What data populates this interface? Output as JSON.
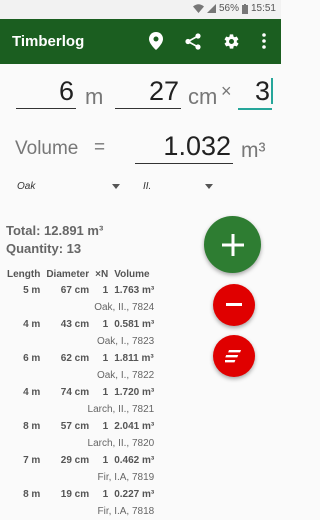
{
  "status": {
    "battery": "56%",
    "time": "15:51"
  },
  "appbar": {
    "title": "Timberlog"
  },
  "inputs": {
    "length_m": "6",
    "length_unit": "m",
    "length_cm": "27",
    "cm_unit": "cm",
    "times": "×",
    "count": "3"
  },
  "volume": {
    "label": "Volume",
    "equals": "=",
    "value": "1.032",
    "unit": "m³"
  },
  "dropdowns": {
    "species": "Oak",
    "grade": "II."
  },
  "summary": {
    "total": "Total: 12.891 m³",
    "quantity": "Quantity: 13"
  },
  "table": {
    "headers": [
      "Length",
      "Diameter",
      "×N",
      "Volume"
    ],
    "rows": [
      {
        "length": "5 m",
        "diameter": "67 cm",
        "n": "1",
        "volume": "1.763 m³",
        "info": "Oak, II., 7824"
      },
      {
        "length": "4 m",
        "diameter": "43 cm",
        "n": "1",
        "volume": "0.581 m³",
        "info": "Oak, I., 7823"
      },
      {
        "length": "6 m",
        "diameter": "62 cm",
        "n": "1",
        "volume": "1.811 m³",
        "info": "Oak, I., 7822"
      },
      {
        "length": "4 m",
        "diameter": "74 cm",
        "n": "1",
        "volume": "1.720 m³",
        "info": "Larch, II., 7821"
      },
      {
        "length": "8 m",
        "diameter": "57 cm",
        "n": "1",
        "volume": "2.041 m³",
        "info": "Larch, II., 7820"
      },
      {
        "length": "7 m",
        "diameter": "29 cm",
        "n": "1",
        "volume": "0.462 m³",
        "info": "Fir, I.A, 7819"
      },
      {
        "length": "8 m",
        "diameter": "19 cm",
        "n": "1",
        "volume": "0.227 m³",
        "info": "Fir, I.A, 7818"
      }
    ]
  },
  "colors": {
    "appbar": "#1b5e20",
    "add_fab": "#2e7d32",
    "red_fab": "#e00000",
    "accent": "#26a69a"
  },
  "icons": [
    "location-icon",
    "share-icon",
    "settings-icon",
    "more-vert-icon",
    "add-icon",
    "remove-icon",
    "list-icon"
  ]
}
